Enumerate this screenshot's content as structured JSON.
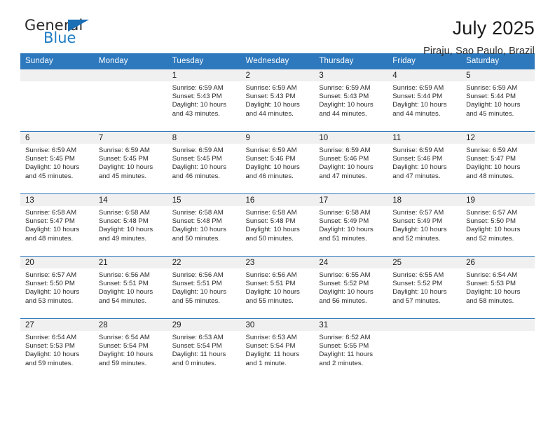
{
  "logo": {
    "word_top": "General",
    "word_bottom": "Blue",
    "brand_color": "#1f7cc4",
    "triangle_color": "#1b6fb5"
  },
  "header": {
    "title": "July 2025",
    "subtitle": "Piraju, Sao Paulo, Brazil",
    "header_bg": "#2e79bd",
    "daynum_bg": "#f0f0f0"
  },
  "weekdays": [
    "Sunday",
    "Monday",
    "Tuesday",
    "Wednesday",
    "Thursday",
    "Friday",
    "Saturday"
  ],
  "weeks": [
    [
      {
        "empty": true
      },
      {
        "empty": true
      },
      {
        "day": "1",
        "sunrise": "Sunrise: 6:59 AM",
        "sunset": "Sunset: 5:43 PM",
        "daylight": "Daylight: 10 hours and 43 minutes."
      },
      {
        "day": "2",
        "sunrise": "Sunrise: 6:59 AM",
        "sunset": "Sunset: 5:43 PM",
        "daylight": "Daylight: 10 hours and 44 minutes."
      },
      {
        "day": "3",
        "sunrise": "Sunrise: 6:59 AM",
        "sunset": "Sunset: 5:43 PM",
        "daylight": "Daylight: 10 hours and 44 minutes."
      },
      {
        "day": "4",
        "sunrise": "Sunrise: 6:59 AM",
        "sunset": "Sunset: 5:44 PM",
        "daylight": "Daylight: 10 hours and 44 minutes."
      },
      {
        "day": "5",
        "sunrise": "Sunrise: 6:59 AM",
        "sunset": "Sunset: 5:44 PM",
        "daylight": "Daylight: 10 hours and 45 minutes."
      }
    ],
    [
      {
        "day": "6",
        "sunrise": "Sunrise: 6:59 AM",
        "sunset": "Sunset: 5:45 PM",
        "daylight": "Daylight: 10 hours and 45 minutes."
      },
      {
        "day": "7",
        "sunrise": "Sunrise: 6:59 AM",
        "sunset": "Sunset: 5:45 PM",
        "daylight": "Daylight: 10 hours and 45 minutes."
      },
      {
        "day": "8",
        "sunrise": "Sunrise: 6:59 AM",
        "sunset": "Sunset: 5:45 PM",
        "daylight": "Daylight: 10 hours and 46 minutes."
      },
      {
        "day": "9",
        "sunrise": "Sunrise: 6:59 AM",
        "sunset": "Sunset: 5:46 PM",
        "daylight": "Daylight: 10 hours and 46 minutes."
      },
      {
        "day": "10",
        "sunrise": "Sunrise: 6:59 AM",
        "sunset": "Sunset: 5:46 PM",
        "daylight": "Daylight: 10 hours and 47 minutes."
      },
      {
        "day": "11",
        "sunrise": "Sunrise: 6:59 AM",
        "sunset": "Sunset: 5:46 PM",
        "daylight": "Daylight: 10 hours and 47 minutes."
      },
      {
        "day": "12",
        "sunrise": "Sunrise: 6:59 AM",
        "sunset": "Sunset: 5:47 PM",
        "daylight": "Daylight: 10 hours and 48 minutes."
      }
    ],
    [
      {
        "day": "13",
        "sunrise": "Sunrise: 6:58 AM",
        "sunset": "Sunset: 5:47 PM",
        "daylight": "Daylight: 10 hours and 48 minutes."
      },
      {
        "day": "14",
        "sunrise": "Sunrise: 6:58 AM",
        "sunset": "Sunset: 5:48 PM",
        "daylight": "Daylight: 10 hours and 49 minutes."
      },
      {
        "day": "15",
        "sunrise": "Sunrise: 6:58 AM",
        "sunset": "Sunset: 5:48 PM",
        "daylight": "Daylight: 10 hours and 50 minutes."
      },
      {
        "day": "16",
        "sunrise": "Sunrise: 6:58 AM",
        "sunset": "Sunset: 5:48 PM",
        "daylight": "Daylight: 10 hours and 50 minutes."
      },
      {
        "day": "17",
        "sunrise": "Sunrise: 6:58 AM",
        "sunset": "Sunset: 5:49 PM",
        "daylight": "Daylight: 10 hours and 51 minutes."
      },
      {
        "day": "18",
        "sunrise": "Sunrise: 6:57 AM",
        "sunset": "Sunset: 5:49 PM",
        "daylight": "Daylight: 10 hours and 52 minutes."
      },
      {
        "day": "19",
        "sunrise": "Sunrise: 6:57 AM",
        "sunset": "Sunset: 5:50 PM",
        "daylight": "Daylight: 10 hours and 52 minutes."
      }
    ],
    [
      {
        "day": "20",
        "sunrise": "Sunrise: 6:57 AM",
        "sunset": "Sunset: 5:50 PM",
        "daylight": "Daylight: 10 hours and 53 minutes."
      },
      {
        "day": "21",
        "sunrise": "Sunrise: 6:56 AM",
        "sunset": "Sunset: 5:51 PM",
        "daylight": "Daylight: 10 hours and 54 minutes."
      },
      {
        "day": "22",
        "sunrise": "Sunrise: 6:56 AM",
        "sunset": "Sunset: 5:51 PM",
        "daylight": "Daylight: 10 hours and 55 minutes."
      },
      {
        "day": "23",
        "sunrise": "Sunrise: 6:56 AM",
        "sunset": "Sunset: 5:51 PM",
        "daylight": "Daylight: 10 hours and 55 minutes."
      },
      {
        "day": "24",
        "sunrise": "Sunrise: 6:55 AM",
        "sunset": "Sunset: 5:52 PM",
        "daylight": "Daylight: 10 hours and 56 minutes."
      },
      {
        "day": "25",
        "sunrise": "Sunrise: 6:55 AM",
        "sunset": "Sunset: 5:52 PM",
        "daylight": "Daylight: 10 hours and 57 minutes."
      },
      {
        "day": "26",
        "sunrise": "Sunrise: 6:54 AM",
        "sunset": "Sunset: 5:53 PM",
        "daylight": "Daylight: 10 hours and 58 minutes."
      }
    ],
    [
      {
        "day": "27",
        "sunrise": "Sunrise: 6:54 AM",
        "sunset": "Sunset: 5:53 PM",
        "daylight": "Daylight: 10 hours and 59 minutes."
      },
      {
        "day": "28",
        "sunrise": "Sunrise: 6:54 AM",
        "sunset": "Sunset: 5:54 PM",
        "daylight": "Daylight: 10 hours and 59 minutes."
      },
      {
        "day": "29",
        "sunrise": "Sunrise: 6:53 AM",
        "sunset": "Sunset: 5:54 PM",
        "daylight": "Daylight: 11 hours and 0 minutes."
      },
      {
        "day": "30",
        "sunrise": "Sunrise: 6:53 AM",
        "sunset": "Sunset: 5:54 PM",
        "daylight": "Daylight: 11 hours and 1 minute."
      },
      {
        "day": "31",
        "sunrise": "Sunrise: 6:52 AM",
        "sunset": "Sunset: 5:55 PM",
        "daylight": "Daylight: 11 hours and 2 minutes."
      },
      {
        "empty": true
      },
      {
        "empty": true
      }
    ]
  ]
}
